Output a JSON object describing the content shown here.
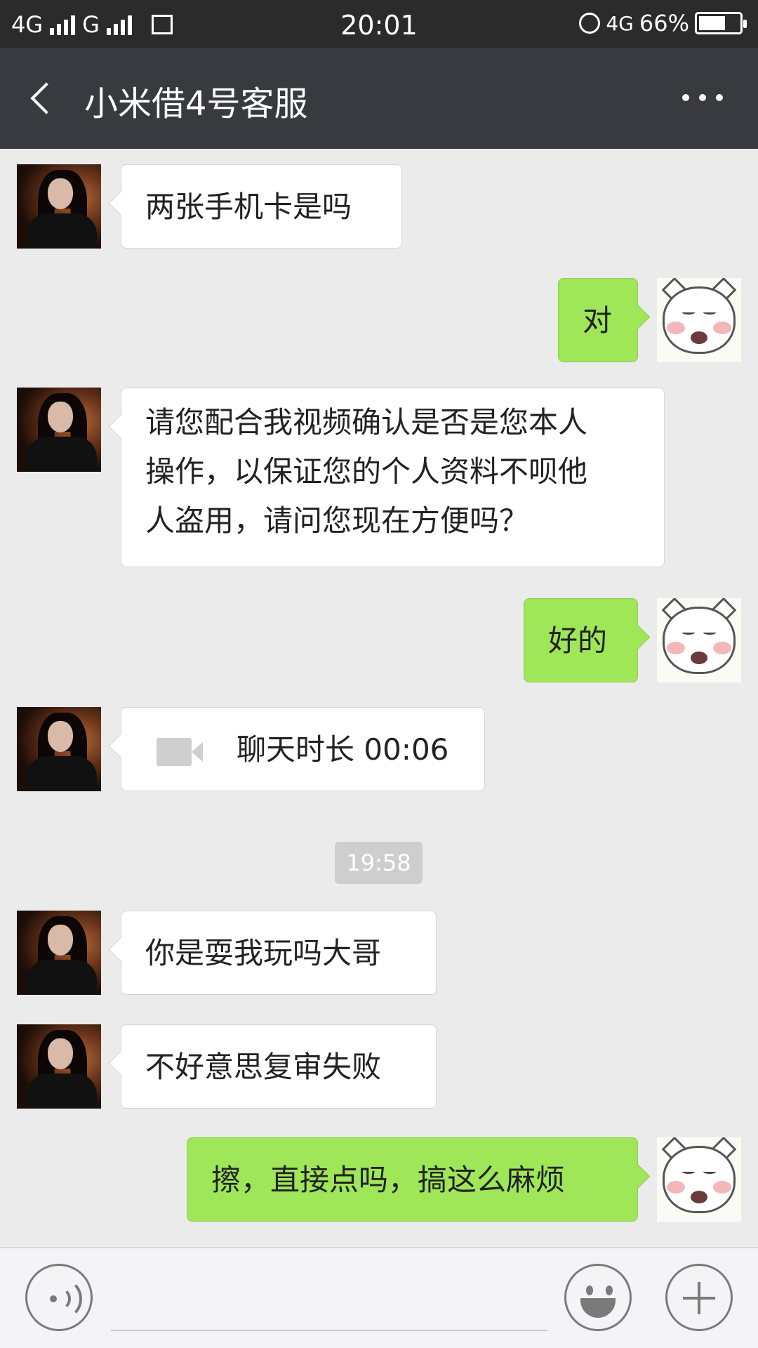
{
  "status_bar": {
    "network1": "4G",
    "network2": "G",
    "time": "20:01",
    "network3": "4G",
    "battery": "66%",
    "battery_level": 0.66
  },
  "header": {
    "title": "小米借4号客服"
  },
  "messages": [
    {
      "from": "contact",
      "text": "两张手机卡是吗"
    },
    {
      "from": "me",
      "text": "对"
    },
    {
      "from": "contact",
      "lines": [
        "请您配合我视频确认是否是您本人",
        "操作，以保证您的个人资料不呗他",
        "人盗用，请问您现在方便吗？"
      ]
    },
    {
      "from": "me",
      "text": "好的"
    },
    {
      "from": "contact",
      "text": "聊天时长 00:06",
      "icon": "video-call-icon"
    },
    {
      "from": "contact",
      "text": "你是耍我玩吗大哥"
    },
    {
      "from": "contact",
      "text": "不好意思复审失败"
    },
    {
      "from": "me",
      "text": "擦，直接点吗，搞这么麻烦"
    }
  ],
  "timestamp": "19:58",
  "colors": {
    "outgoing_bubble": "#9fe658",
    "incoming_bubble": "#ffffff",
    "header_bg": "#393a3f",
    "chat_bg": "#ebebeb"
  }
}
